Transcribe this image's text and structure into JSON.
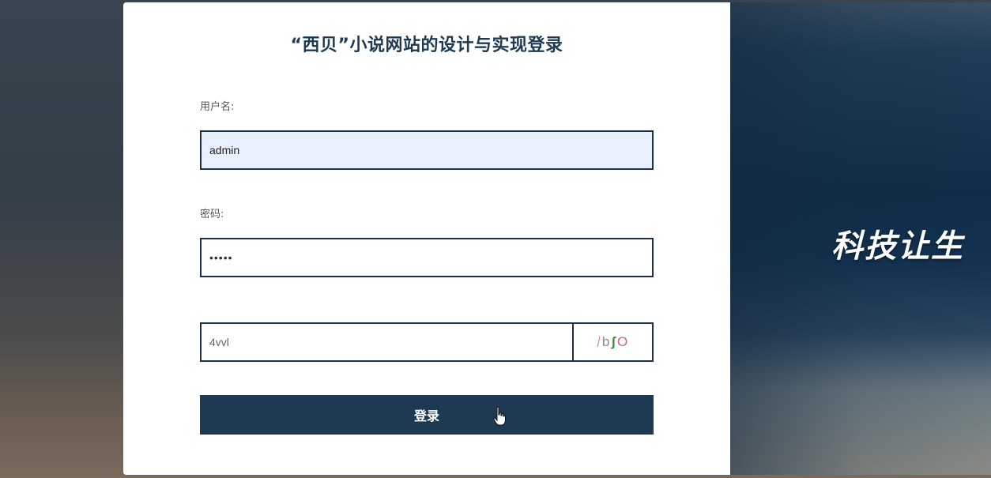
{
  "login": {
    "title": "“西贝”小说网站的设计与实现登录",
    "username_label": "用户名:",
    "username_value": "admin",
    "password_label": "密码:",
    "password_value": "•••••",
    "captcha_value": "4vvl",
    "captcha_chars": [
      "⁄",
      "b",
      "ʃ",
      "O"
    ],
    "captcha_colors": [
      "#d070b0",
      "#8a8aa0",
      "#3a8a3a",
      "#d06090"
    ],
    "login_button": "登录"
  },
  "banner": {
    "slogan": "科技让生"
  },
  "colors": {
    "primary": "#1e3a52",
    "input_border": "#1b2f45",
    "autofill_bg": "#e8f0fe"
  }
}
